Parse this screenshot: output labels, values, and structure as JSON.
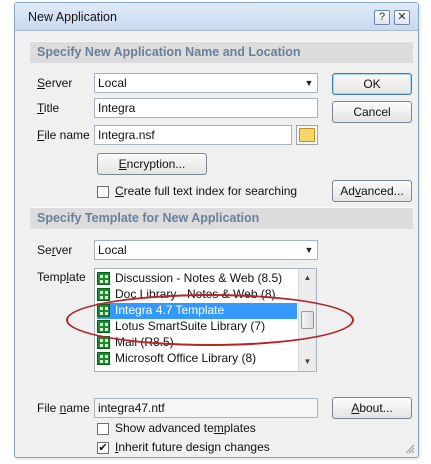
{
  "window": {
    "title": "New Application",
    "help_btn": "?",
    "close_btn": "✕"
  },
  "section1": {
    "heading": "Specify New Application Name and Location",
    "server_label_u": "S",
    "server_label_rest": "erver",
    "server_value": "Local",
    "title_label_u": "T",
    "title_label_rest": "itle",
    "title_value": "Integra",
    "filename_label_u": "F",
    "filename_label_rest": "ile name",
    "filename_value": "Integra.nsf",
    "encryption_u": "E",
    "encryption_rest": "ncryption...",
    "fulltext_u": "C",
    "fulltext_rest": "reate full text index for searching",
    "ok": "OK",
    "cancel": "Cancel",
    "advanced_pre": "Ad",
    "advanced_u": "v",
    "advanced_post": "anced..."
  },
  "section2": {
    "heading": "Specify Template for New Application",
    "server_label_pre": "Se",
    "server_label_u": "r",
    "server_label_post": "ver",
    "server_value": "Local",
    "template_label_pre": "Temp",
    "template_label_u": "l",
    "template_label_post": "ate",
    "templates": [
      "Discussion - Notes & Web (8.5)",
      "Doc Library - Notes & Web (8)",
      "Integra 4.7 Template",
      "Lotus SmartSuite Library (7)",
      "Mail (R8.5)",
      "Microsoft Office Library (8)"
    ],
    "selected_index": 2,
    "filename_label_pre": "File ",
    "filename_label_u": "n",
    "filename_label_post": "ame",
    "filename_value": "integra47.ntf",
    "about_u": "A",
    "about_rest": "bout...",
    "show_adv_pre": "Show advanced te",
    "show_adv_u": "m",
    "show_adv_post": "plates",
    "show_adv_checked": false,
    "inherit_u": "I",
    "inherit_rest": "nherit future design changes",
    "inherit_checked": true,
    "checkmark": "✔"
  },
  "icons": {
    "dropdown": "▼",
    "scroll_up": "▲",
    "scroll_down": "▼"
  },
  "colors": {
    "annotation": "#b3262b",
    "selection": "#3399ff",
    "section_text": "#6a7f9b"
  }
}
